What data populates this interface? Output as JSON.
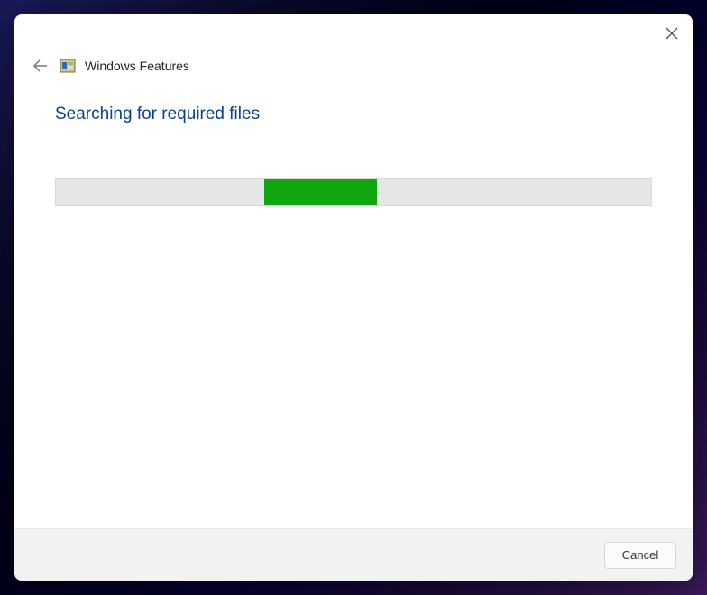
{
  "window": {
    "title": "Windows Features"
  },
  "content": {
    "status_heading": "Searching for required files"
  },
  "progress": {
    "indeterminate": true,
    "chunk_left_pct": 35,
    "chunk_width_pct": 19,
    "color": "#0fa60f",
    "track_color": "#e6e6e6"
  },
  "footer": {
    "cancel_label": "Cancel"
  }
}
